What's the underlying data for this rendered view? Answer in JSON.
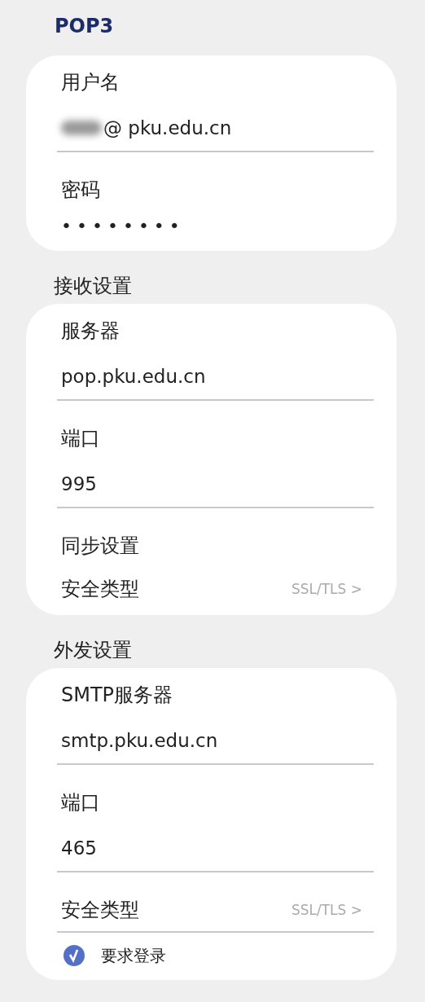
{
  "title": "POP3",
  "sections": [
    {
      "rows": [
        {
          "kind": "field",
          "label": "用户名",
          "value": "@ pku.edu.cn",
          "redacted": true
        },
        {
          "kind": "password",
          "label": "密码",
          "value": "••••••••"
        }
      ]
    },
    {
      "heading": "接收设置",
      "rows": [
        {
          "kind": "field",
          "label": "服务器",
          "value": "pop.pku.edu.cn"
        },
        {
          "kind": "field",
          "label": "端口",
          "value": "995"
        },
        {
          "kind": "label",
          "label": "同步设置"
        },
        {
          "kind": "select",
          "label": "安全类型",
          "value": "SSL/TLS >"
        }
      ]
    },
    {
      "heading": "外发设置",
      "rows": [
        {
          "kind": "field",
          "label": "SMTP服务器",
          "value": "smtp.pku.edu.cn"
        },
        {
          "kind": "field",
          "label": "端口",
          "value": "465"
        },
        {
          "kind": "select",
          "label": "安全类型",
          "value": "SSL/TLS >"
        },
        {
          "kind": "checkbox",
          "label": "要求登录",
          "checked": true
        }
      ]
    }
  ]
}
